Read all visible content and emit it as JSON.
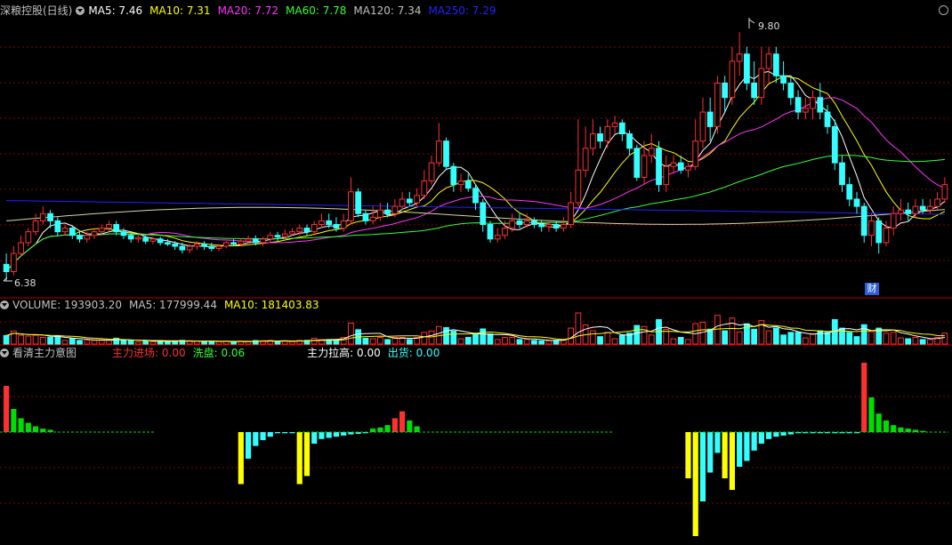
{
  "price_panel": {
    "title": "深粮控股(日线)",
    "indicators": [
      {
        "label": "MA5: 7.46",
        "color": "#ffffff"
      },
      {
        "label": "MA10: 7.31",
        "color": "#ffff00"
      },
      {
        "label": "MA20: 7.72",
        "color": "#ff33ff"
      },
      {
        "label": "MA60: 7.78",
        "color": "#33ff33"
      },
      {
        "label": "MA120: 7.34",
        "color": "#c0c0c0"
      },
      {
        "label": "MA250: 7.29",
        "color": "#2222ff"
      }
    ],
    "high_label": "9.80",
    "low_label": "6.38",
    "event_badge": "财"
  },
  "volume_panel": {
    "indicators": [
      {
        "label": "VOLUME: 193903.20",
        "color": "#c0c0c0"
      },
      {
        "label": "MA5: 177999.44",
        "color": "#c0c0c0"
      },
      {
        "label": "MA10: 181403.83",
        "color": "#ffff00"
      }
    ]
  },
  "flow_panel": {
    "title": "看清主力意图",
    "indicators": [
      {
        "label": "主力进场: 0.00",
        "color": "#ff3030"
      },
      {
        "label": "洗盘: 0.06",
        "color": "#33ff33"
      },
      {
        "label": "主力拉高: 0.00",
        "color": "#ffffff"
      },
      {
        "label": "出货: 0.00",
        "color": "#33ffff"
      }
    ]
  },
  "colors": {
    "up": "#ff3030",
    "down": "#33ffff",
    "grid": "#8b0000",
    "yellow": "#ffff00",
    "green": "#00dd00"
  },
  "chart_data": {
    "type": "candlestick",
    "candles": [
      [
        6.6,
        6.5,
        6.75,
        6.38
      ],
      [
        6.5,
        6.75,
        6.85,
        6.45
      ],
      [
        6.75,
        6.9,
        7.0,
        6.7
      ],
      [
        6.9,
        7.05,
        7.1,
        6.85
      ],
      [
        7.05,
        7.2,
        7.3,
        7.0
      ],
      [
        7.2,
        7.3,
        7.4,
        7.15
      ],
      [
        7.3,
        7.2,
        7.35,
        7.1
      ],
      [
        7.2,
        7.05,
        7.25,
        7.0
      ],
      [
        7.05,
        7.1,
        7.15,
        7.0
      ],
      [
        7.1,
        7.0,
        7.12,
        6.95
      ],
      [
        7.0,
        6.95,
        7.05,
        6.9
      ],
      [
        6.95,
        7.0,
        7.05,
        6.9
      ],
      [
        7.0,
        7.05,
        7.1,
        6.95
      ],
      [
        7.05,
        7.1,
        7.15,
        7.0
      ],
      [
        7.1,
        7.15,
        7.2,
        7.05
      ],
      [
        7.15,
        7.05,
        7.2,
        7.0
      ],
      [
        7.05,
        7.0,
        7.1,
        6.95
      ],
      [
        7.0,
        6.95,
        7.05,
        6.9
      ],
      [
        6.95,
        6.97,
        7.0,
        6.9
      ],
      [
        6.97,
        6.92,
        7.0,
        6.88
      ],
      [
        6.92,
        6.95,
        6.98,
        6.88
      ],
      [
        6.95,
        6.9,
        6.98,
        6.86
      ],
      [
        6.9,
        6.88,
        6.95,
        6.85
      ],
      [
        6.88,
        6.85,
        6.92,
        6.8
      ],
      [
        6.85,
        6.8,
        6.9,
        6.75
      ],
      [
        6.8,
        6.85,
        6.88,
        6.75
      ],
      [
        6.85,
        6.88,
        6.92,
        6.8
      ],
      [
        6.88,
        6.85,
        6.92,
        6.8
      ],
      [
        6.85,
        6.82,
        6.9,
        6.78
      ],
      [
        6.82,
        6.85,
        6.88,
        6.78
      ],
      [
        6.85,
        6.9,
        6.92,
        6.82
      ],
      [
        6.9,
        6.88,
        6.95,
        6.85
      ],
      [
        6.88,
        6.92,
        6.96,
        6.85
      ],
      [
        6.92,
        6.95,
        7.0,
        6.9
      ],
      [
        6.95,
        6.9,
        7.0,
        6.86
      ],
      [
        6.9,
        6.95,
        6.98,
        6.85
      ],
      [
        6.95,
        7.0,
        7.05,
        6.9
      ],
      [
        7.0,
        6.98,
        7.05,
        6.92
      ],
      [
        6.98,
        7.02,
        7.08,
        6.95
      ],
      [
        7.02,
        7.05,
        7.1,
        7.0
      ],
      [
        7.05,
        7.1,
        7.15,
        7.0
      ],
      [
        7.1,
        7.05,
        7.15,
        7.0
      ],
      [
        7.05,
        7.15,
        7.2,
        7.0
      ],
      [
        7.15,
        7.2,
        7.3,
        7.1
      ],
      [
        7.2,
        7.15,
        7.3,
        7.1
      ],
      [
        7.15,
        7.1,
        7.25,
        7.05
      ],
      [
        7.1,
        7.2,
        7.3,
        7.05
      ],
      [
        7.2,
        7.6,
        7.8,
        7.15
      ],
      [
        7.6,
        7.3,
        7.65,
        7.25
      ],
      [
        7.3,
        7.2,
        7.35,
        7.15
      ],
      [
        7.2,
        7.25,
        7.4,
        7.15
      ],
      [
        7.25,
        7.35,
        7.45,
        7.2
      ],
      [
        7.35,
        7.3,
        7.45,
        7.25
      ],
      [
        7.3,
        7.4,
        7.5,
        7.25
      ],
      [
        7.4,
        7.5,
        7.6,
        7.35
      ],
      [
        7.5,
        7.45,
        7.6,
        7.4
      ],
      [
        7.45,
        7.55,
        7.65,
        7.4
      ],
      [
        7.55,
        7.75,
        7.9,
        7.5
      ],
      [
        7.75,
        8.0,
        8.1,
        7.7
      ],
      [
        8.0,
        8.3,
        8.55,
        7.95
      ],
      [
        8.3,
        7.95,
        8.35,
        7.9
      ],
      [
        7.95,
        7.7,
        8.0,
        7.6
      ],
      [
        7.7,
        7.75,
        7.85,
        7.6
      ],
      [
        7.75,
        7.65,
        7.85,
        7.6
      ],
      [
        7.65,
        7.45,
        7.7,
        7.35
      ],
      [
        7.45,
        7.15,
        7.5,
        7.05
      ],
      [
        7.15,
        6.95,
        7.2,
        6.9
      ],
      [
        6.95,
        7.0,
        7.1,
        6.9
      ],
      [
        7.0,
        7.1,
        7.2,
        6.95
      ],
      [
        7.1,
        7.2,
        7.3,
        7.05
      ],
      [
        7.2,
        7.15,
        7.3,
        7.1
      ],
      [
        7.15,
        7.2,
        7.3,
        7.1
      ],
      [
        7.2,
        7.15,
        7.25,
        7.1
      ],
      [
        7.15,
        7.12,
        7.2,
        7.05
      ],
      [
        7.12,
        7.15,
        7.2,
        7.05
      ],
      [
        7.15,
        7.1,
        7.2,
        7.05
      ],
      [
        7.1,
        7.15,
        7.25,
        7.05
      ],
      [
        7.15,
        7.45,
        7.6,
        7.1
      ],
      [
        7.45,
        7.9,
        8.6,
        7.4
      ],
      [
        7.9,
        8.2,
        8.5,
        7.8
      ],
      [
        8.2,
        8.4,
        8.6,
        8.1
      ],
      [
        8.4,
        8.3,
        8.5,
        8.2
      ],
      [
        8.3,
        8.5,
        8.6,
        8.2
      ],
      [
        8.5,
        8.55,
        8.65,
        8.4
      ],
      [
        8.55,
        8.4,
        8.6,
        8.3
      ],
      [
        8.4,
        8.2,
        8.45,
        8.1
      ],
      [
        8.2,
        7.8,
        8.25,
        7.75
      ],
      [
        7.8,
        8.1,
        8.3,
        7.7
      ],
      [
        8.1,
        8.2,
        8.4,
        8.0
      ],
      [
        8.2,
        7.7,
        8.3,
        7.6
      ],
      [
        7.7,
        7.95,
        8.1,
        7.6
      ],
      [
        7.95,
        8.0,
        8.1,
        7.85
      ],
      [
        8.0,
        7.9,
        8.1,
        7.85
      ],
      [
        7.9,
        7.95,
        8.0,
        7.8
      ],
      [
        7.95,
        8.3,
        8.6,
        7.9
      ],
      [
        8.3,
        8.7,
        8.9,
        8.2
      ],
      [
        8.7,
        8.5,
        8.9,
        8.3
      ],
      [
        8.5,
        9.1,
        9.2,
        8.4
      ],
      [
        9.1,
        8.9,
        9.2,
        8.7
      ],
      [
        8.9,
        9.4,
        9.6,
        8.8
      ],
      [
        9.4,
        9.5,
        9.8,
        9.2
      ],
      [
        9.5,
        9.1,
        9.6,
        9.0
      ],
      [
        9.1,
        8.9,
        9.4,
        8.8
      ],
      [
        8.9,
        9.3,
        9.6,
        8.8
      ],
      [
        9.3,
        9.5,
        9.6,
        9.1
      ],
      [
        9.5,
        9.2,
        9.6,
        9.1
      ],
      [
        9.2,
        9.1,
        9.4,
        9.0
      ],
      [
        9.1,
        8.9,
        9.2,
        8.8
      ],
      [
        8.9,
        8.7,
        9.0,
        8.6
      ],
      [
        8.7,
        8.75,
        8.9,
        8.6
      ],
      [
        8.75,
        8.9,
        9.0,
        8.6
      ],
      [
        8.9,
        8.7,
        9.1,
        8.6
      ],
      [
        8.7,
        8.5,
        8.8,
        8.4
      ],
      [
        8.5,
        8.0,
        8.6,
        7.9
      ],
      [
        8.0,
        7.7,
        8.1,
        7.6
      ],
      [
        7.7,
        7.5,
        7.8,
        7.4
      ],
      [
        7.5,
        7.4,
        7.6,
        7.3
      ],
      [
        7.4,
        7.0,
        7.45,
        6.9
      ],
      [
        7.0,
        7.2,
        7.3,
        6.85
      ],
      [
        7.2,
        6.9,
        7.25,
        6.75
      ],
      [
        6.9,
        7.1,
        7.2,
        6.85
      ],
      [
        7.1,
        7.3,
        7.4,
        7.0
      ],
      [
        7.3,
        7.35,
        7.5,
        7.2
      ],
      [
        7.35,
        7.3,
        7.45,
        7.2
      ],
      [
        7.3,
        7.4,
        7.5,
        7.25
      ],
      [
        7.4,
        7.35,
        7.5,
        7.3
      ],
      [
        7.35,
        7.4,
        7.5,
        7.3
      ],
      [
        7.4,
        7.5,
        7.6,
        7.35
      ],
      [
        7.5,
        7.7,
        7.8,
        7.45
      ]
    ],
    "xlabel": "",
    "ylabel": "",
    "grid": true
  }
}
